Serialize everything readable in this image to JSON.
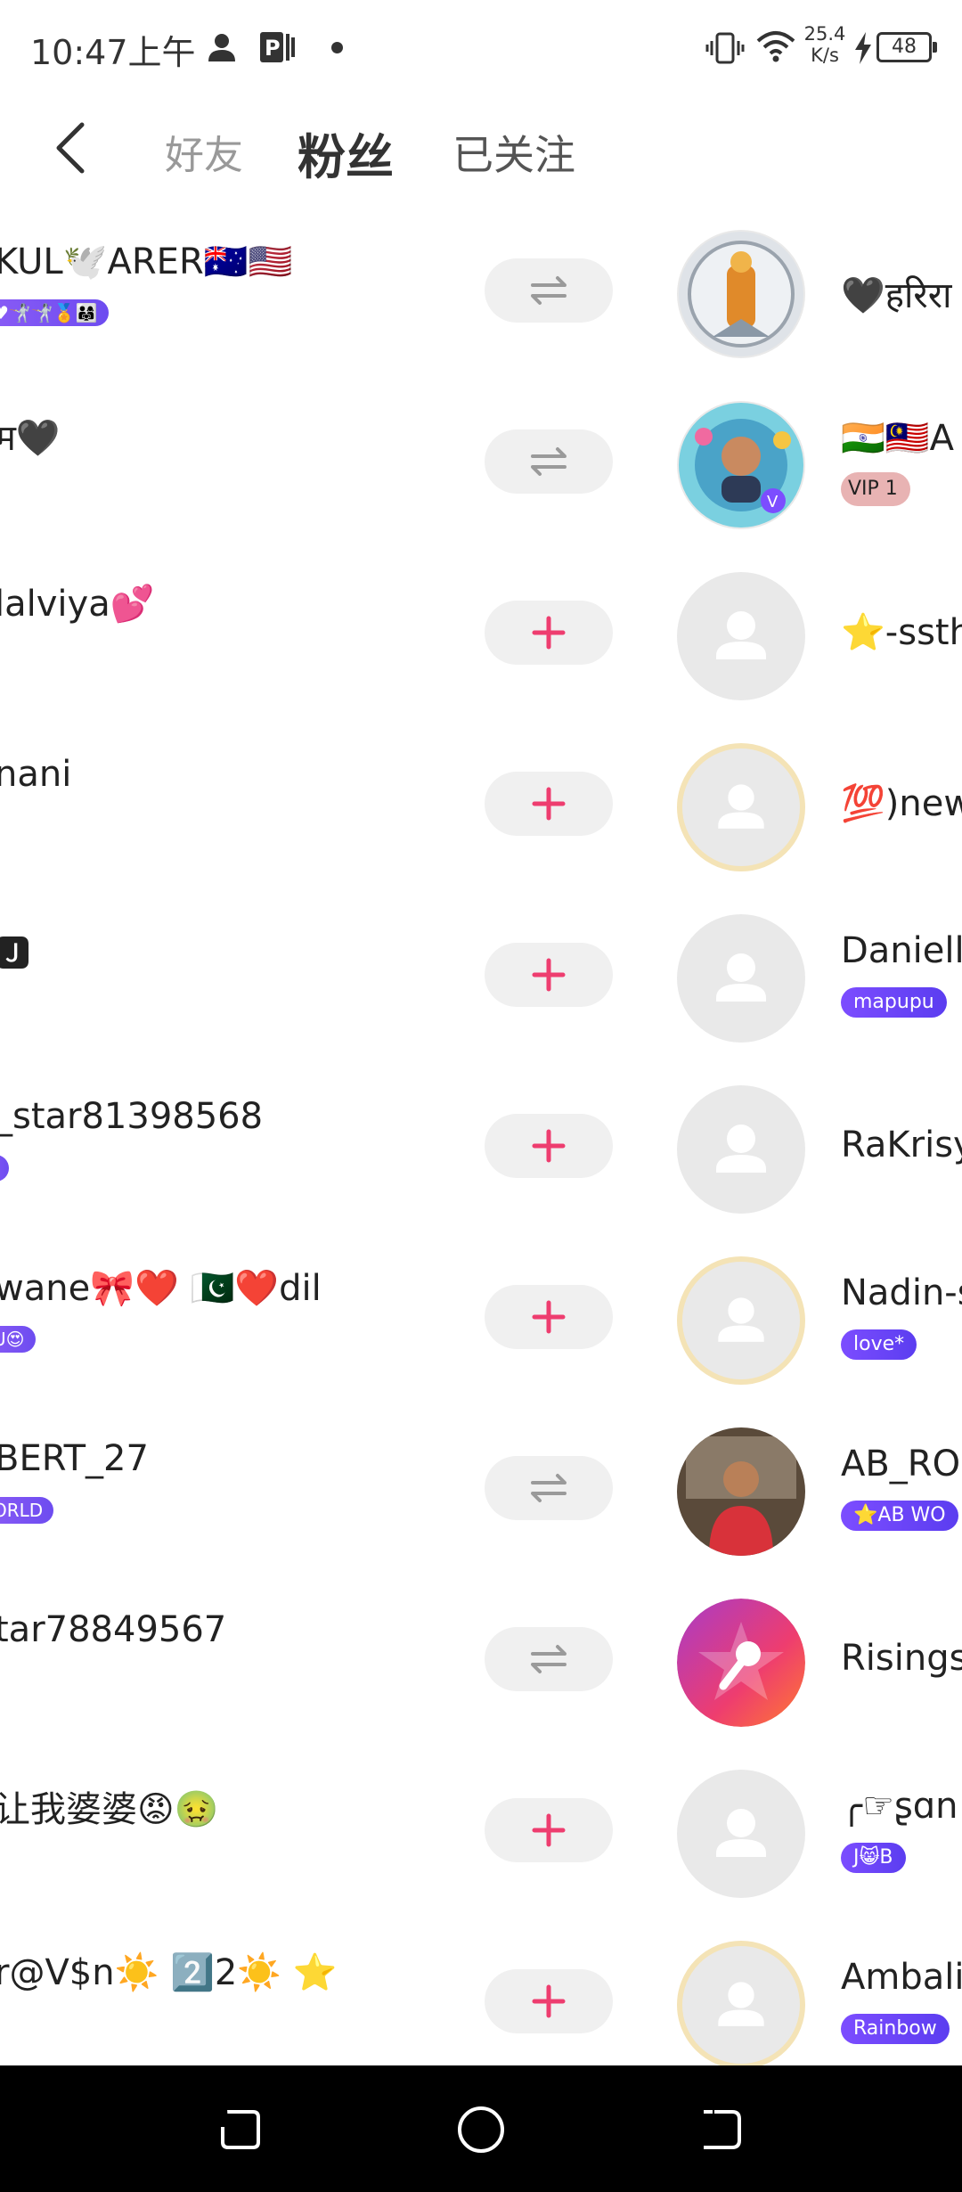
{
  "status_bar": {
    "time": "10:47上午",
    "speed": "25.4 K/s",
    "battery": "48",
    "icons": [
      "person-icon",
      "p-app-icon",
      "vibrate-icon",
      "wifi-icon",
      "charging-icon",
      "battery-icon"
    ]
  },
  "header": {
    "back_icon": "chevron-left-icon",
    "tabs": [
      "好友",
      "粉丝",
      "已关注"
    ],
    "active_tab": "粉丝"
  },
  "colors": {
    "plus": "#ee3d6f",
    "mutual": "#9a9a9a",
    "button_bg": "#f0f0f0",
    "badge": "#6d4cf0",
    "avatar_placeholder": "#e9e9e9"
  },
  "rows": [
    {
      "left_name": "KUL🕊️ARER🇦🇺🇺🇸",
      "left_badge": "♥🤺🤺🏅👨‍👩‍👧",
      "action": "mutual",
      "right_name": "🖤हरिरा",
      "right_badge": "",
      "right_vip": "",
      "avatar": "deity"
    },
    {
      "left_name": "म🖤",
      "left_badge": "",
      "action": "mutual",
      "right_name": "🇮🇳🇲🇾A",
      "right_badge": "",
      "right_vip": "VIP 1",
      "avatar": "man-frame"
    },
    {
      "left_name": "lalviya💕",
      "left_badge": "",
      "action": "follow",
      "right_name": "⭐-ssth",
      "right_badge": "",
      "right_vip": "",
      "avatar": "placeholder"
    },
    {
      "left_name": "nani",
      "left_badge": "",
      "action": "follow",
      "right_name": "💯)new",
      "right_badge": "",
      "right_vip": "",
      "avatar": "placeholder-frame"
    },
    {
      "left_name": "🅹",
      "left_badge": "",
      "action": "follow",
      "right_name": "Daniella",
      "right_badge": "mapupu",
      "right_vip": "",
      "avatar": "placeholder"
    },
    {
      "left_name": "_star81398568",
      "left_badge": "I",
      "action": "follow",
      "right_name": "RaKrisy",
      "right_badge": "",
      "right_vip": "",
      "avatar": "placeholder"
    },
    {
      "left_name": "wane🎀❤️ 🇵🇰❤️dil",
      "left_badge": "U😍",
      "action": "follow",
      "right_name": "Nadin-s",
      "right_badge": "love*",
      "right_vip": "",
      "avatar": "placeholder-frame"
    },
    {
      "left_name": "BERT_27",
      "left_badge": "ORLD",
      "action": "mutual",
      "right_name": "AB_ROB",
      "right_badge": "⭐AB WO",
      "right_vip": "",
      "avatar": "photo"
    },
    {
      "left_name": "tar78849567",
      "left_badge": "",
      "action": "mutual",
      "right_name": "Risings",
      "right_badge": "",
      "right_vip": "",
      "avatar": "star-logo"
    },
    {
      "left_name": "让我婆婆😡🤢",
      "left_badge": "",
      "action": "follow",
      "right_name": "╭☞ʂɑn",
      "right_badge": "J😸B",
      "right_vip": "",
      "avatar": "placeholder"
    },
    {
      "left_name": "r@V$n☀️ 2️⃣2☀️ ⭐",
      "left_badge": "",
      "action": "follow",
      "right_name": "Ambalil",
      "right_badge": "Rainbow",
      "right_vip": "",
      "avatar": "placeholder-frame"
    }
  ],
  "nav": [
    "recents-icon",
    "home-icon",
    "back-icon"
  ]
}
